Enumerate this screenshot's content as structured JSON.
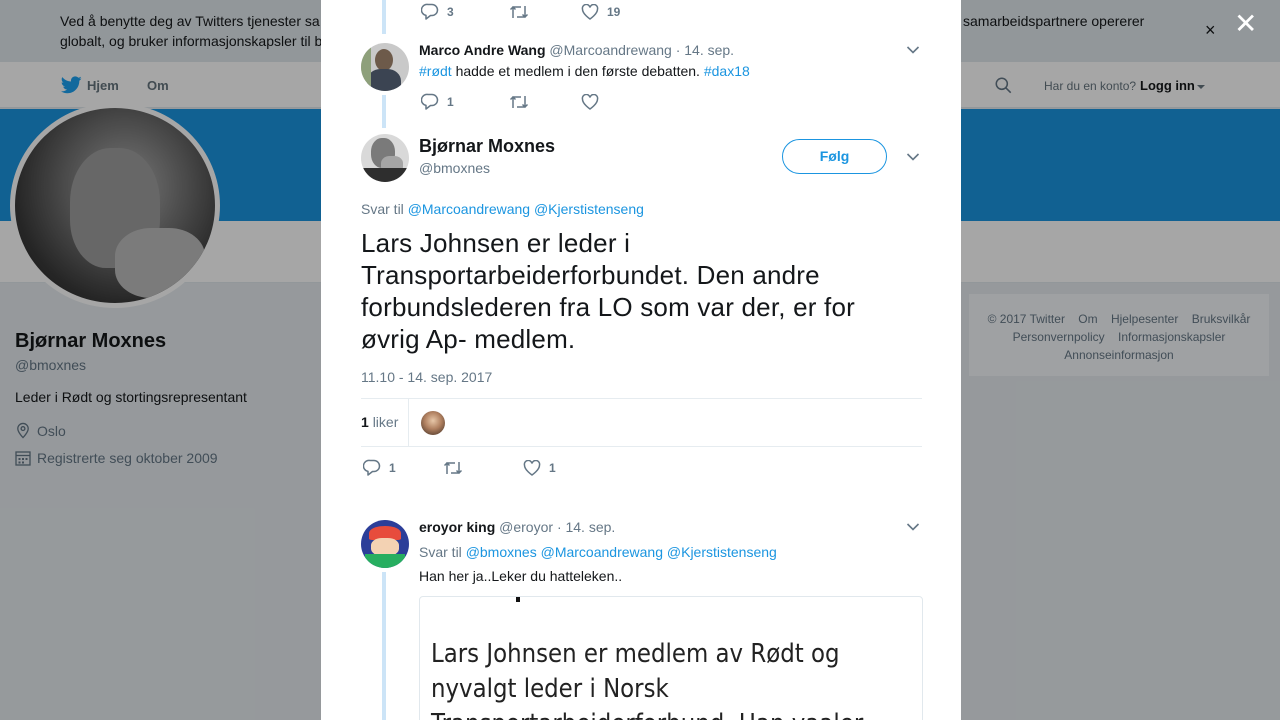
{
  "cookie_bar": {
    "line1_left": "Ved å benytte deg av Twitters tjenester sa",
    "line1_right": "samarbeidspartnere opererer",
    "line2": "globalt, og bruker informasjonskapsler til b"
  },
  "topnav": {
    "home": "Hjem",
    "about": "Om",
    "has_account": "Har du en konto?",
    "login": "Logg inn"
  },
  "profile": {
    "name": "Bjørnar Moxnes",
    "handle": "@bmoxnes",
    "bio": "Leder i Rødt og stortingsrepresentant",
    "location": "Oslo",
    "joined": "Registrerte seg oktober 2009"
  },
  "footer": {
    "copyright": "© 2017 Twitter",
    "links": [
      "Om",
      "Hjelpesenter",
      "Bruksvilkår",
      "Personvernpolicy",
      "Informasjonskapsler",
      "Annonseinformasjon"
    ]
  },
  "tweet_top": {
    "replies": "3",
    "likes": "19"
  },
  "tweet_marco": {
    "name": "Marco Andre Wang",
    "handle": "@Marcoandrewang",
    "date": "· 14. sep.",
    "hashtag1": "#rødt",
    "text": " hadde et medlem i den første debatten. ",
    "hashtag2": "#dax18",
    "replies": "1"
  },
  "main_tweet": {
    "name": "Bjørnar Moxnes",
    "handle": "@bmoxnes",
    "follow": "Følg",
    "reply_prefix": "Svar til",
    "reply_1": "@Marcoandrewang",
    "reply_2": "@Kjerstistenseng",
    "text": "Lars Johnsen er leder i Transportarbeiderforbundet. Den andre forbundslederen fra LO som var der, er for øvrig Ap- medlem.",
    "timestamp": "11.10 - 14. sep. 2017",
    "like_count": "1",
    "like_label": "liker",
    "replies": "1",
    "likes": "1"
  },
  "tweet_eroyor": {
    "name": "eroyor king",
    "handle": "@eroyor",
    "date": "· 14. sep.",
    "reply_prefix": "Svar til",
    "reply_1": "@bmoxnes",
    "reply_2": "@Marcoandrewang",
    "reply_3": "@Kjerstistenseng",
    "text": "Han her ja..Leker du hatteleken..",
    "media_line1": "Lars Johnsen er medlem av Rødt og",
    "media_line2": "nyvalgt leder i Norsk",
    "media_line3": "Transportarbeiderforbund. Han vaaler"
  },
  "colors": {
    "twitter_blue": "#1b95e0",
    "thread_line": "#cce4f7"
  }
}
